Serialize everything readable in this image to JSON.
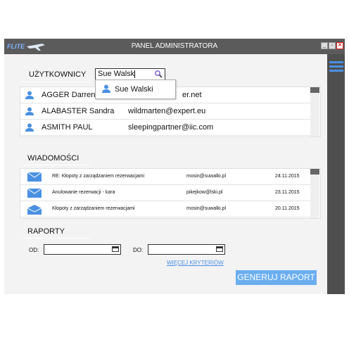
{
  "window": {
    "title": "PANEL ADMINISTRATORA",
    "logo": "FLITE",
    "controls": [
      "minimize",
      "restore",
      "close"
    ]
  },
  "users": {
    "heading": "UŻYTKOWNICY",
    "search_value": "Sue Walsk",
    "suggestion": "Sue Walski",
    "rows": [
      {
        "name": "AGGER Darren",
        "email": "dar…er.net",
        "email_visible": "er.net"
      },
      {
        "name": "ALABASTER Sandra",
        "email": "wildmarten@expert.eu"
      },
      {
        "name": "ASMITH PAUL",
        "email": "sleepingpartner@iic.com"
      }
    ]
  },
  "messages": {
    "heading": "WIADOMOŚCI",
    "rows": [
      {
        "subject": "RE: Kłopoty z zarządzaniem rezerwacjami",
        "email": "mosin@suwalki.pl",
        "date": "24.11.2015",
        "icon": "envelope-closed-icon"
      },
      {
        "subject": "Anulowanie rezerwacji - kara",
        "email": "pikejkow@lski.pl",
        "date": "23.11.2015",
        "icon": "envelope-closed-icon"
      },
      {
        "subject": "Kłopoty z zarządzaniem rezerwacjami",
        "email": "mosin@suwalki.pl",
        "date": "20.11.2015",
        "icon": "envelope-open-icon"
      }
    ]
  },
  "reports": {
    "heading": "RAPORTY",
    "from_label": "OD:",
    "to_label": "DO:",
    "more_criteria": "WIĘCEJ KRYTERIÓW",
    "generate": "GENERUJ RAPORT"
  },
  "colors": {
    "accent": "#4a90e2",
    "titlebar": "#5b5b5b",
    "sidebar": "#4f4f4f",
    "button": "#6aaef0"
  }
}
